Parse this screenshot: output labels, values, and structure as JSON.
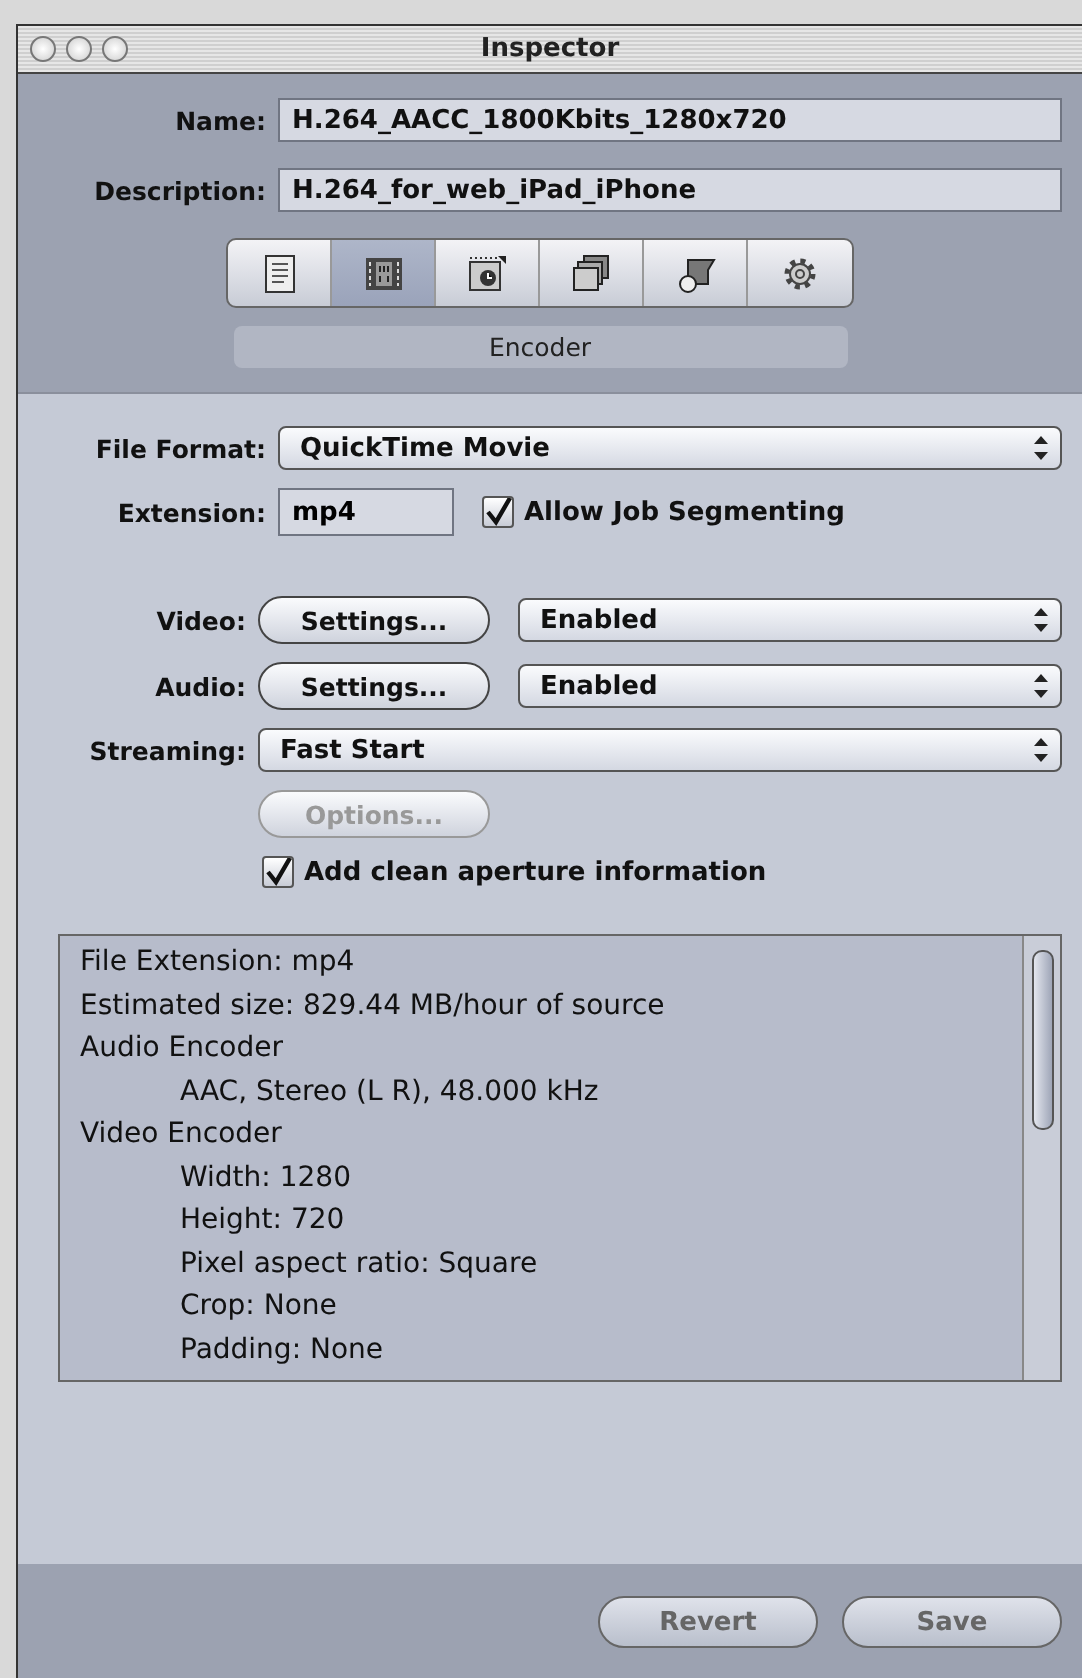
{
  "window": {
    "title": "Inspector"
  },
  "name": {
    "label": "Name:",
    "value": "H.264_AACC_1800Kbits_1280x720"
  },
  "description": {
    "label": "Description:",
    "value": "H.264_for_web_iPad_iPhone"
  },
  "tabs": [
    {
      "kind": "document",
      "selected": false
    },
    {
      "kind": "filmstrip",
      "selected": true
    },
    {
      "kind": "timer",
      "selected": false
    },
    {
      "kind": "layers",
      "selected": false
    },
    {
      "kind": "shapes",
      "selected": false
    },
    {
      "kind": "gear",
      "selected": false
    }
  ],
  "section_label": "Encoder",
  "file_format": {
    "label": "File Format:",
    "value": "QuickTime Movie"
  },
  "extension": {
    "label": "Extension:",
    "value": "mp4"
  },
  "allow_job_segmenting": {
    "label": "Allow Job Segmenting",
    "checked": true
  },
  "video": {
    "label": "Video:",
    "button": "Settings...",
    "value": "Enabled"
  },
  "audio": {
    "label": "Audio:",
    "button": "Settings...",
    "value": "Enabled"
  },
  "streaming": {
    "label": "Streaming:",
    "value": "Fast Start"
  },
  "options_button": {
    "label": "Options...",
    "disabled": true
  },
  "clean_aperture": {
    "label": "Add clean aperture information",
    "checked": true
  },
  "summary": [
    {
      "text": "File Extension: mp4"
    },
    {
      "text": "Estimated size: 829.44 MB/hour of source"
    },
    {
      "text": "Audio Encoder",
      "children": [
        {
          "text": "AAC, Stereo (L R), 48.000 kHz"
        }
      ]
    },
    {
      "text": "Video Encoder",
      "children": [
        {
          "text": "Width: 1280"
        },
        {
          "text": "Height: 720"
        },
        {
          "text": "Pixel aspect ratio: Square"
        },
        {
          "text": "Crop: None"
        },
        {
          "text": "Padding: None"
        }
      ]
    }
  ],
  "buttons": [
    {
      "label": "Revert",
      "disabled": true
    },
    {
      "label": "Save",
      "disabled": true
    }
  ]
}
